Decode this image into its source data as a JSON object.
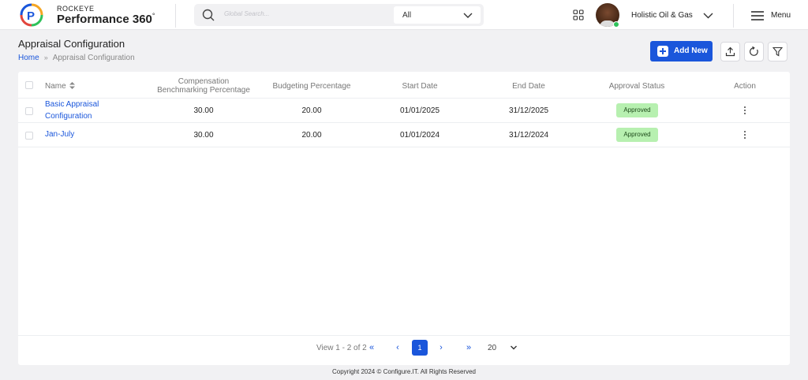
{
  "brand": {
    "small": "ROCKEYE",
    "big": "Performance 360",
    "sup": "°"
  },
  "search": {
    "placeholder": "Global Search...",
    "scope_value": "All"
  },
  "user": {
    "company": "Holistic Oil & Gas"
  },
  "menu": {
    "label": "Menu"
  },
  "page": {
    "title": "Appraisal Configuration"
  },
  "breadcrumb": {
    "home": "Home",
    "separator": "»",
    "current": "Appraisal Configuration"
  },
  "toolbar": {
    "add_label": "Add New"
  },
  "table": {
    "columns": {
      "name": "Name",
      "comp_line1": "Compensation",
      "comp_line2": "Benchmarking Percentage",
      "budget": "Budgeting Percentage",
      "start": "Start Date",
      "end": "End Date",
      "status": "Approval Status",
      "action": "Action"
    },
    "rows": [
      {
        "name_line1": "Basic Appraisal",
        "name_line2": "Configuration",
        "comp": "30.00",
        "budget": "20.00",
        "start": "01/01/2025",
        "end": "31/12/2025",
        "status": "Approved"
      },
      {
        "name_line1": "Jan-July",
        "name_line2": "",
        "comp": "30.00",
        "budget": "20.00",
        "start": "01/01/2024",
        "end": "31/12/2024",
        "status": "Approved"
      }
    ]
  },
  "pagination": {
    "summary": "View 1 - 2 of 2",
    "first": "«",
    "prev": "‹",
    "current": "1",
    "next": "›",
    "last": "»",
    "per_page": "20"
  },
  "footer": {
    "copyright": "Copyright 2024 © Configure.IT. All Rights Reserved"
  },
  "colors": {
    "primary": "#1a56db",
    "approved_bg": "#b7f0b0",
    "online": "#2ec25a"
  }
}
